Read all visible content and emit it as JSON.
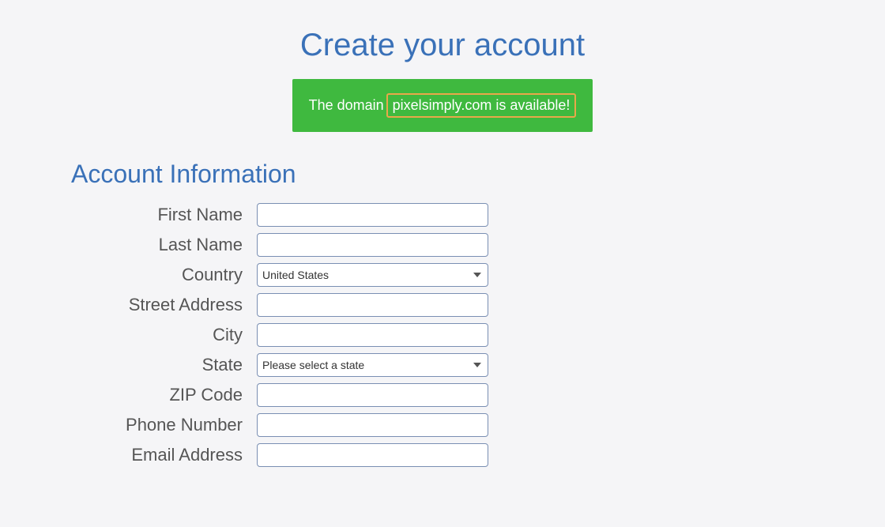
{
  "header": {
    "title": "Create your account"
  },
  "banner": {
    "prefix": "The domain",
    "highlighted": "pixelsimply.com is available!"
  },
  "section": {
    "title": "Account Information"
  },
  "form": {
    "first_name": {
      "label": "First Name",
      "value": ""
    },
    "last_name": {
      "label": "Last Name",
      "value": ""
    },
    "country": {
      "label": "Country",
      "selected": "United States"
    },
    "street_address": {
      "label": "Street Address",
      "value": ""
    },
    "city": {
      "label": "City",
      "value": ""
    },
    "state": {
      "label": "State",
      "selected": "Please select a state"
    },
    "zip_code": {
      "label": "ZIP Code",
      "value": ""
    },
    "phone_number": {
      "label": "Phone Number",
      "value": ""
    },
    "email_address": {
      "label": "Email Address",
      "value": ""
    }
  }
}
